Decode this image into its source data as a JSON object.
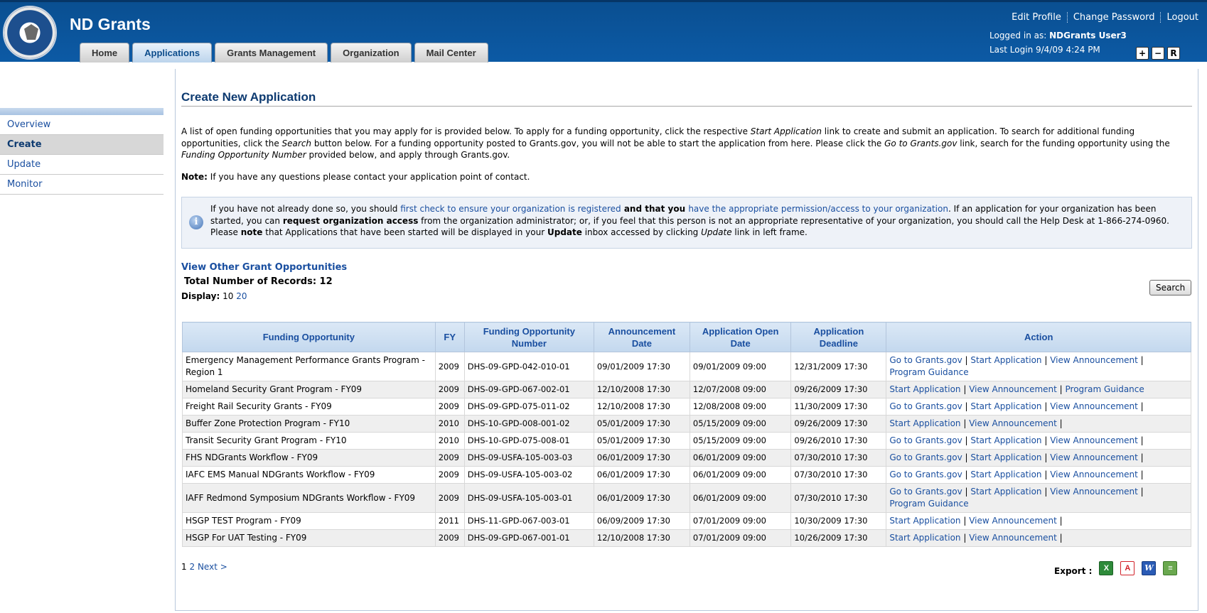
{
  "header": {
    "app_title": "ND Grants",
    "tabs": [
      "Home",
      "Applications",
      "Grants Management",
      "Organization",
      "Mail Center"
    ],
    "active_tab": "Applications",
    "links": {
      "edit_profile": "Edit Profile",
      "change_password": "Change Password",
      "logout": "Logout"
    },
    "logged_in_label": "Logged in as:",
    "logged_in_user": "NDGrants User3",
    "last_login": "Last Login 9/4/09 4:24 PM",
    "zoom_buttons": [
      "+",
      "−",
      "R"
    ]
  },
  "leftnav": {
    "items": [
      "Overview",
      "Create",
      "Update",
      "Monitor"
    ],
    "active": "Create"
  },
  "main": {
    "title": "Create New Application",
    "intro": {
      "p1": "A list of open funding opportunities that you may apply for is provided below. To apply for a funding opportunity, click the respective ",
      "start_app_em": "Start Application",
      "p2": " link to create and submit an application. To search for additional funding opportunities, click the ",
      "search_em": "Search",
      "p3": " button below. For a funding opportunity posted to Grants.gov, you will not be able to start the application from here. Please click the ",
      "gotogrants_em": "Go to Grants.gov",
      "p4": " link, search for the funding opportunity using the ",
      "fon_em": "Funding Opportunity Number",
      "p5": " provided below, and apply through Grants.gov."
    },
    "note_label": "Note:",
    "note_text": " If you have any questions please contact your application point of contact.",
    "infobox": {
      "t1": "If you have not already done so, you should ",
      "link1": "first check to ensure your organization is registered",
      "t2": " and that you ",
      "link2": "have the appropriate permission/access to your organization",
      "t3": ". If an application for your organization has been started, you can ",
      "b1": "request organization access",
      "t4": " from the organization administrator; or, if you feel that this person is not an appropriate representative of your organization, you should call the Help Desk at 1-866-274-0960. Please ",
      "b2": "note",
      "t5": " that Applications that have been started will be displayed in your ",
      "b3": "Update",
      "t6": " inbox accessed by clicking ",
      "em1": "Update",
      "t7": " link in left frame."
    },
    "view_other": "View Other Grant Opportunities",
    "total_records": "Total Number of Records: 12",
    "display_label": "Display:",
    "display_current": "10",
    "display_other": "20",
    "search_button": "Search",
    "table": {
      "headers": [
        "Funding Opportunity",
        "FY",
        "Funding Opportunity Number",
        "Announcement Date",
        "Application Open Date",
        "Application Deadline",
        "Action"
      ],
      "rows": [
        [
          "Emergency Management Performance Grants Program - Region 1",
          "2009",
          "DHS-09-GPD-042-010-01",
          "09/01/2009 17:30",
          "09/01/2009 09:00",
          "12/31/2009 17:30"
        ],
        [
          "Homeland Security Grant Program - FY09",
          "2009",
          "DHS-09-GPD-067-002-01",
          "12/10/2008 17:30",
          "12/07/2008 09:00",
          "09/26/2009 17:30"
        ],
        [
          "Freight Rail Security Grants - FY09",
          "2009",
          "DHS-09-GPD-075-011-02",
          "12/10/2008 17:30",
          "12/08/2008 09:00",
          "11/30/2009 17:30"
        ],
        [
          "Buffer Zone Protection Program - FY10",
          "2010",
          "DHS-10-GPD-008-001-02",
          "05/01/2009 17:30",
          "05/15/2009 09:00",
          "09/26/2009 17:30"
        ],
        [
          "Transit Security Grant Program - FY10",
          "2010",
          "DHS-10-GPD-075-008-01",
          "05/01/2009 17:30",
          "05/15/2009 09:00",
          "09/26/2010 17:30"
        ],
        [
          "FHS NDGrants Workflow - FY09",
          "2009",
          "DHS-09-USFA-105-003-03",
          "06/01/2009 17:30",
          "06/01/2009 09:00",
          "07/30/2010 17:30"
        ],
        [
          "IAFC EMS Manual NDGrants Workflow - FY09",
          "2009",
          "DHS-09-USFA-105-003-02",
          "06/01/2009 17:30",
          "06/01/2009 09:00",
          "07/30/2010 17:30"
        ],
        [
          "IAFF Redmond Symposium NDGrants Workflow - FY09",
          "2009",
          "DHS-09-USFA-105-003-01",
          "06/01/2009 17:30",
          "06/01/2009 09:00",
          "07/30/2010 17:30"
        ],
        [
          "HSGP TEST Program - FY09",
          "2011",
          "DHS-11-GPD-067-003-01",
          "06/09/2009 17:30",
          "07/01/2009 09:00",
          "10/30/2009 17:30"
        ],
        [
          "HSGP For UAT Testing - FY09",
          "2009",
          "DHS-09-GPD-067-001-01",
          "12/10/2008 17:30",
          "07/01/2009 09:00",
          "10/26/2009 17:30"
        ]
      ],
      "actions": [
        [
          [
            "Go to Grants.gov",
            "Start Application",
            "View Announcement"
          ],
          [
            "Program Guidance"
          ]
        ],
        [
          [
            "Start Application",
            "View Announcement",
            "Program Guidance"
          ]
        ],
        [
          [
            "Go to Grants.gov",
            "Start Application",
            "View Announcement"
          ]
        ],
        [
          [
            "Start Application",
            "View Announcement"
          ]
        ],
        [
          [
            "Go to Grants.gov",
            "Start Application",
            "View Announcement"
          ]
        ],
        [
          [
            "Go to Grants.gov",
            "Start Application",
            "View Announcement"
          ]
        ],
        [
          [
            "Go to Grants.gov",
            "Start Application",
            "View Announcement"
          ]
        ],
        [
          [
            "Go to Grants.gov",
            "Start Application",
            "View Announcement"
          ],
          [
            "Program Guidance"
          ]
        ],
        [
          [
            "Start Application",
            "View Announcement"
          ]
        ],
        [
          [
            "Start Application",
            "View Announcement"
          ]
        ]
      ],
      "trailing_pipe": [
        true,
        false,
        true,
        true,
        true,
        true,
        true,
        true,
        true,
        true
      ]
    },
    "pager": {
      "current": "1",
      "page2": "2",
      "next": "Next >"
    },
    "export_label": "Export :",
    "export_icons": [
      "excel-icon",
      "pdf-icon",
      "word-icon",
      "csv-icon"
    ]
  }
}
